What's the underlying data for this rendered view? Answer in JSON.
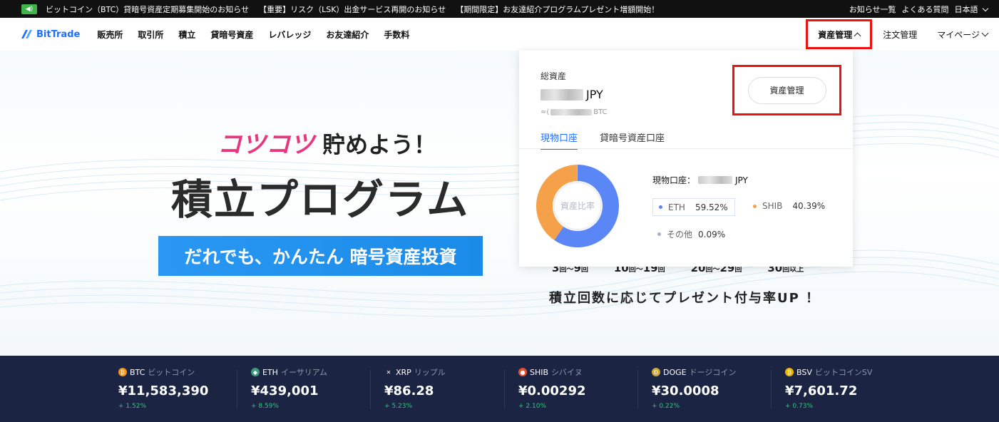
{
  "announcement": {
    "items": [
      "ビットコイン（BTC）貸暗号資産定期募集開始のお知らせ",
      "【重要】リスク（LSK）出金サービス再開のお知らせ",
      "【期間限定】お友達紹介プログラムプレゼント増額開始！"
    ],
    "links": [
      "お知らせ一覧",
      "よくある質問",
      "日本語"
    ]
  },
  "nav": {
    "logo": "BitTrade",
    "menu": [
      "販売所",
      "取引所",
      "積立",
      "貸暗号資産",
      "レバレッジ",
      "お友達紹介",
      "手数料"
    ],
    "asset_management": "資産管理",
    "order_management": "注文管理",
    "my_page": "マイページ"
  },
  "hero": {
    "catch_pink": "コツコツ",
    "catch_rest": "貯めよう！",
    "title": "積立プログラム",
    "cta": "だれでも、かんたん 暗号資産投資",
    "tiers": [
      {
        "range": "3",
        "unit1": "回",
        "sep": "～",
        "to": "9",
        "unit2": "回"
      },
      {
        "range": "10",
        "unit1": "回",
        "sep": "～",
        "to": "19",
        "unit2": "回"
      },
      {
        "range": "20",
        "unit1": "回",
        "sep": "～",
        "to": "29",
        "unit2": "回"
      },
      {
        "range": "30",
        "unit1": "回以上",
        "sep": "",
        "to": "",
        "unit2": ""
      }
    ],
    "bonus": "積立回数に応じてプレゼント付与率UP ！"
  },
  "dropdown": {
    "total_label": "総資産",
    "total_currency": "JPY",
    "btc_prefix": "≈(",
    "btc_currency": "BTC",
    "button": "資産管理",
    "tabs": [
      "現物口座",
      "貸暗号資産口座"
    ],
    "donut_label": "資産比率",
    "account_label": "現物口座：",
    "account_currency": "JPY",
    "breakdown": [
      {
        "name": "ETH",
        "pct": "59.52%",
        "value": 59.52,
        "color": "#5b86f5"
      },
      {
        "name": "SHIB",
        "pct": "40.39%",
        "value": 40.39,
        "color": "#f5a14a"
      },
      {
        "name": "その他",
        "pct": "0.09%",
        "value": 0.09,
        "color": "#c8cfdd"
      }
    ]
  },
  "ticker": [
    {
      "symbol": "BTC",
      "name": "ビットコイン",
      "price": "¥11,583,390",
      "change": "+ 1.52%",
      "color": "#f7931a",
      "glyph": "₿"
    },
    {
      "symbol": "ETH",
      "name": "イーサリアム",
      "price": "¥439,001",
      "change": "+ 8.59%",
      "color": "#3c9b7a",
      "glyph": "◆"
    },
    {
      "symbol": "XRP",
      "name": "リップル",
      "price": "¥86.28",
      "change": "+ 5.23%",
      "color": "#1b2442",
      "glyph": "✕"
    },
    {
      "symbol": "SHIB",
      "name": "シバイヌ",
      "price": "¥0.00292",
      "change": "+ 2.10%",
      "color": "#e8502f",
      "glyph": "●"
    },
    {
      "symbol": "DOGE",
      "name": "ドージコイン",
      "price": "¥30.0008",
      "change": "+ 0.22%",
      "color": "#c8a83a",
      "glyph": "Ð"
    },
    {
      "symbol": "BSV",
      "name": "ビットコインSV",
      "price": "¥7,601.72",
      "change": "+ 0.73%",
      "color": "#eab300",
      "glyph": "₿"
    }
  ]
}
